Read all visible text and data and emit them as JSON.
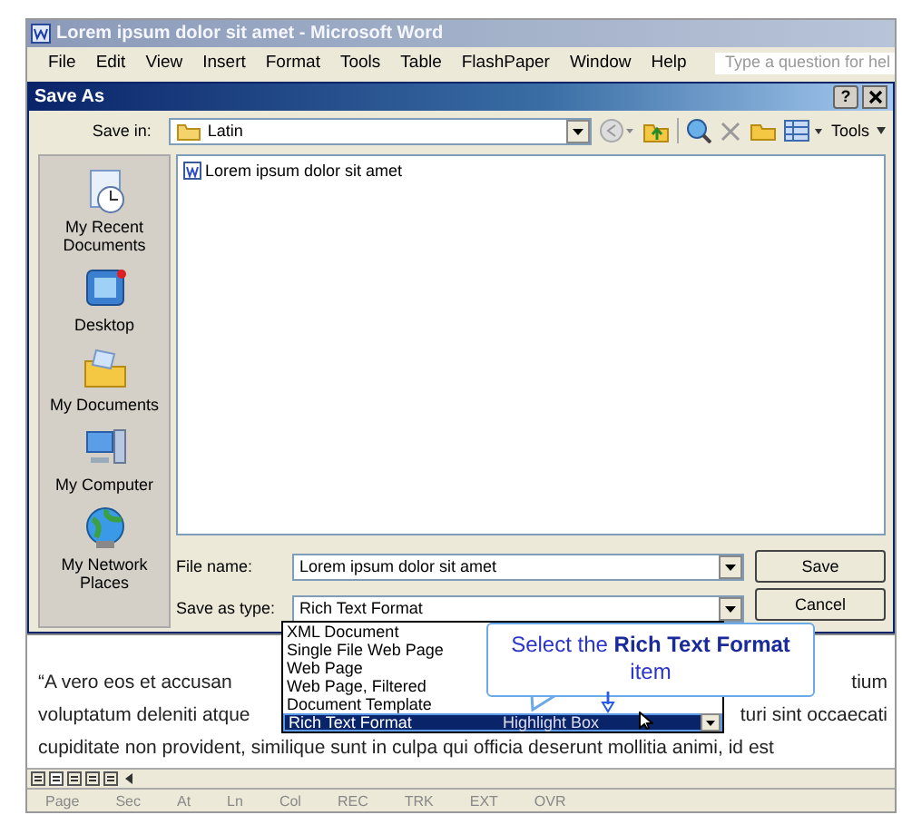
{
  "word_window": {
    "title": "Lorem ipsum dolor sit amet - Microsoft Word"
  },
  "menu": [
    "File",
    "Edit",
    "View",
    "Insert",
    "Format",
    "Tools",
    "Table",
    "FlashPaper",
    "Window",
    "Help"
  ],
  "ask_field": {
    "placeholder": "Type a question for hel"
  },
  "dialog": {
    "title": "Save As",
    "help_button": "?"
  },
  "save_in": {
    "label": "Save in:",
    "value": "Latin"
  },
  "tools_menu": "Tools",
  "places": [
    {
      "label": "My Recent Documents",
      "kind": "recent"
    },
    {
      "label": "Desktop",
      "kind": "desktop"
    },
    {
      "label": "My Documents",
      "kind": "documents"
    },
    {
      "label": "My Computer",
      "kind": "computer"
    },
    {
      "label": "My Network Places",
      "kind": "network"
    }
  ],
  "files": [
    {
      "name": "Lorem ipsum dolor sit amet",
      "selected": false
    }
  ],
  "file_name": {
    "label": "File name:",
    "value": "Lorem ipsum dolor sit amet"
  },
  "save_type": {
    "label": "Save as type:",
    "value": "Rich Text Format"
  },
  "type_options": [
    {
      "label": "XML Document",
      "selected": false
    },
    {
      "label": "Single File Web Page",
      "selected": false
    },
    {
      "label": "Web Page",
      "selected": false
    },
    {
      "label": "Web Page, Filtered",
      "selected": false
    },
    {
      "label": "Document Template",
      "selected": false
    },
    {
      "label": "Rich Text Format",
      "selected": true
    }
  ],
  "highlight_box": {
    "label": "Highlight Box"
  },
  "buttons": [
    "Save",
    "Cancel"
  ],
  "callout": {
    "text": "Select the **Rich Text Format** item"
  },
  "document": {
    "lines": [
      {
        "left": "“A vero eos et accusan",
        "right": "tium"
      },
      {
        "left": "voluptatum deleniti atque",
        "right": "turi sint occaecati"
      },
      {
        "left": "cupiditate non provident, similique sunt in culpa qui officia deserunt mollitia animi, id est"
      }
    ]
  },
  "status_bar": [
    "Page",
    "Sec",
    "At",
    "Ln",
    "Col",
    "REC",
    "TRK",
    "EXT",
    "OVR"
  ]
}
